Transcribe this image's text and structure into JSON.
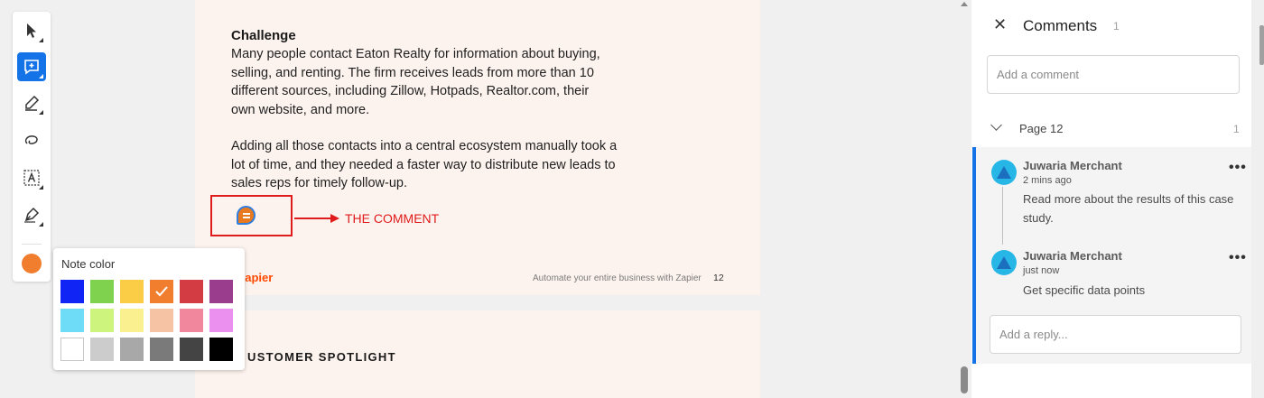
{
  "document": {
    "page1": {
      "challenge_title": "Challenge",
      "paragraph1": "Many people contact Eaton Realty for information about buying, selling, and renting. The firm receives leads from more than 10 different sources, including Zillow, Hotpads, Realtor.com, their own website, and more.",
      "paragraph2": "Adding all those contacts into a central ecosystem manually took a lot of time, and they needed a faster way to distribute new leads to sales reps for timely follow-up.",
      "annotation_label": "THE COMMENT",
      "footer_brand": "_apier",
      "footer_text": "Automate your entire business with Zapier",
      "footer_page": "12"
    },
    "page2": {
      "heading": "USTOMER SPOTLIGHT"
    }
  },
  "toolbar": {
    "tools": [
      "select-tool",
      "add-comment-tool",
      "highlight-tool",
      "draw-freeform-tool",
      "add-text-tool",
      "sign-tool"
    ],
    "active_tool": "add-comment-tool",
    "current_color": "#f07e2e"
  },
  "note_color": {
    "title": "Note color",
    "selected": "#f07e2e",
    "swatches": [
      [
        "#1025f5",
        "#7ed24e",
        "#fbcd47",
        "#f07e2e",
        "#d23c42",
        "#9a3d8c"
      ],
      [
        "#6edbf7",
        "#cdf57e",
        "#fbf08f",
        "#f7c3a5",
        "#f0879c",
        "#ec90f0"
      ],
      [
        "#ffffff",
        "#cccccc",
        "#a8a8a8",
        "#7a7a7a",
        "#444444",
        "#000000"
      ]
    ]
  },
  "comments_panel": {
    "title": "Comments",
    "count": "1",
    "add_comment_placeholder": "Add a comment",
    "page_group": {
      "label": "Page 12",
      "count": "1"
    },
    "thread": [
      {
        "author": "Juwaria Merchant",
        "time": "2 mins ago",
        "text": "Read more about the results of this case study."
      },
      {
        "author": "Juwaria Merchant",
        "time": "just now",
        "text": "Get specific data points"
      }
    ],
    "reply_placeholder": "Add a reply..."
  }
}
